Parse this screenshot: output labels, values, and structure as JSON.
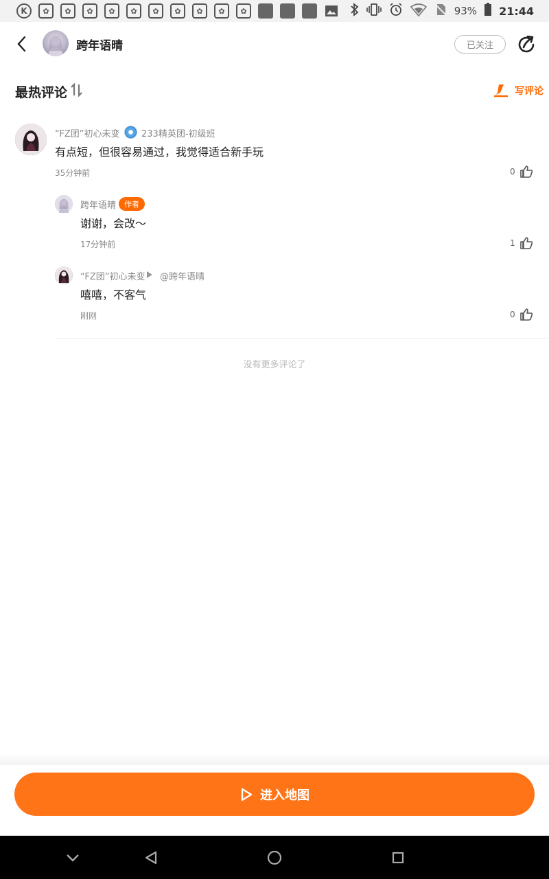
{
  "status_bar": {
    "k_icon": "K",
    "app_icon_count": 10,
    "battery": "93%",
    "time": "21:44"
  },
  "header": {
    "title": "跨年语晴",
    "follow_label": "已关注"
  },
  "section": {
    "title": "最热评论",
    "write_label": "写评论"
  },
  "comments": [
    {
      "name": "“FZ团”初心未变",
      "badge": "233精英团-初级班",
      "text": "有点短，但很容易通过，我觉得适合新手玩",
      "time": "35分钟前",
      "likes": "0"
    }
  ],
  "replies": [
    {
      "name": "跨年语晴",
      "tag": "作者",
      "text": "谢谢，会改～",
      "time": "17分钟前",
      "likes": "1"
    },
    {
      "name": "“FZ团”初心未变",
      "reply_to": "@跨年语晴",
      "text": "嘻嘻，不客气",
      "time": "刚刚",
      "likes": "0"
    }
  ],
  "footer": {
    "no_more": "没有更多评论了",
    "enter_map": "进入地图"
  },
  "colors": {
    "accent": "#ff7417",
    "tag": "#ff6a00",
    "nav_bg": "#000000"
  }
}
